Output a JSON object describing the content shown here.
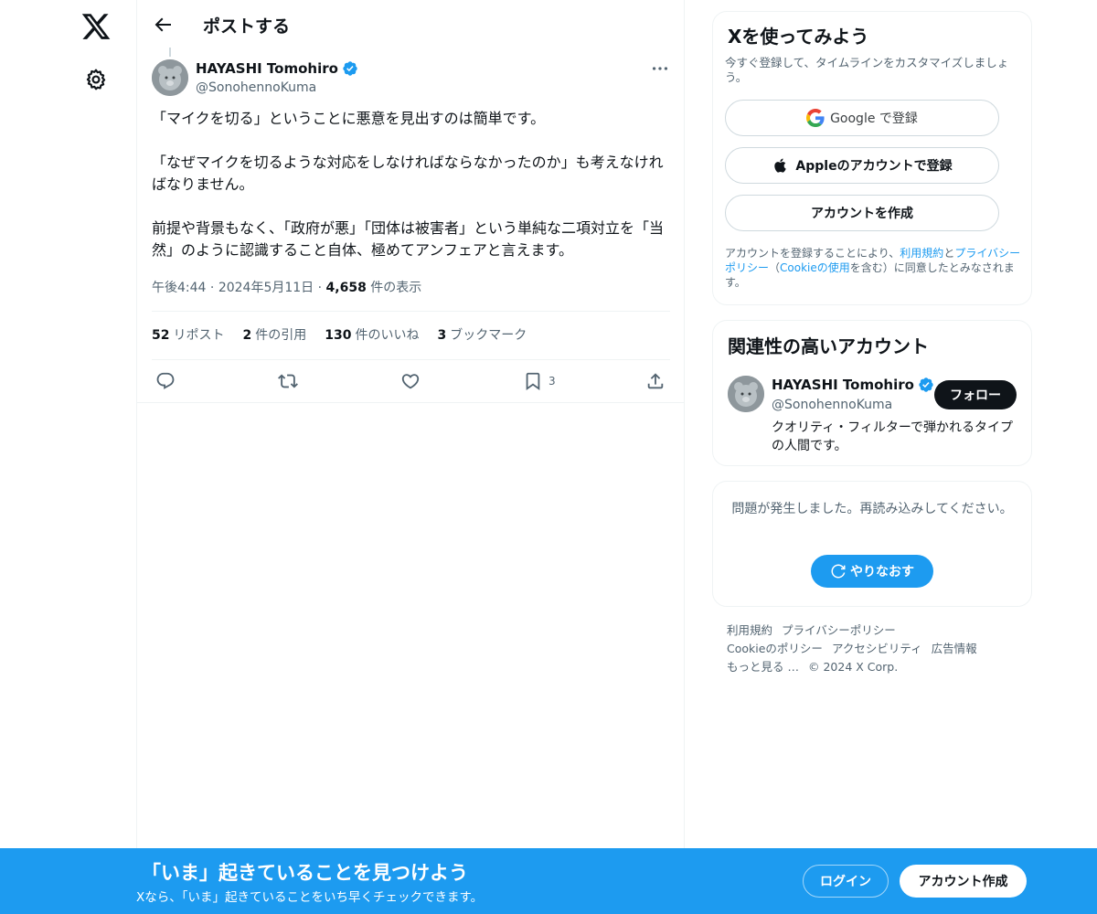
{
  "colors": {
    "accent": "#1d9bf0",
    "text": "#0f1419",
    "muted": "#536471",
    "border": "#eff3f4"
  },
  "nav": {
    "logo_icon": "x-logo-icon",
    "settings_icon": "gear-icon"
  },
  "header": {
    "title": "ポストする"
  },
  "post": {
    "author_name": "HAYASHI Tomohiro",
    "author_handle": "@SonohennoKuma",
    "text": "「マイクを切る」ということに悪意を見出すのは簡単です。\n\n「なぜマイクを切るような対応をしなければならなかったのか」も考えなければなりません。\n\n前提や背景もなく、「政府が悪」「団体は被害者」という単純な二項対立を「当然」のように認識すること自体、極めてアンフェアと言えます。",
    "time": "午後4:44",
    "date": "2024年5月11日",
    "views": "4,658",
    "views_label": "件の表示",
    "stats": [
      {
        "value": "52",
        "label": "リポスト"
      },
      {
        "value": "2",
        "label": "件の引用"
      },
      {
        "value": "130",
        "label": "件のいいね"
      },
      {
        "value": "3",
        "label": "ブックマーク"
      }
    ],
    "bookmark_count": "3"
  },
  "signup_card": {
    "title": "Xを使ってみよう",
    "subtitle": "今すぐ登録して、タイムラインをカスタマイズしましょう。",
    "google_label": "Google で登録",
    "apple_label": "Appleのアカウントで登録",
    "create_label": "アカウントを作成",
    "legal_prefix": "アカウントを登録することにより、",
    "legal_terms": "利用規約",
    "legal_and": "と",
    "legal_privacy": "プライバシーポリシー",
    "legal_paren_open": "（",
    "legal_cookie": "Cookieの使用",
    "legal_suffix": "を含む）に同意したとみなされます。"
  },
  "related": {
    "title": "関連性の高いアカウント",
    "name": "HAYASHI Tomohiro",
    "handle": "@SonohennoKuma",
    "follow_label": "フォロー",
    "bio": "クオリティ・フィルターで弾かれるタイプの人間です。"
  },
  "error_card": {
    "message": "問題が発生しました。再読み込みしてください。",
    "retry_label": "やりなおす"
  },
  "footer": {
    "terms": "利用規約",
    "privacy": "プライバシーポリシー",
    "cookie": "Cookieのポリシー",
    "accessibility": "アクセシビリティ",
    "ads": "広告情報",
    "more": "もっと見る …",
    "copyright": "© 2024 X Corp."
  },
  "banner": {
    "title": "「いま」起きていることを見つけよう",
    "subtitle": "Xなら、「いま」起きていることをいち早くチェックできます。",
    "login_label": "ログイン",
    "signup_label": "アカウント作成"
  }
}
